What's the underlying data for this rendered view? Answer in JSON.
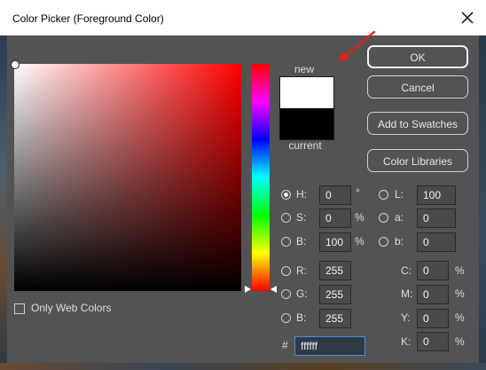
{
  "window": {
    "title": "Color Picker (Foreground Color)"
  },
  "preview": {
    "new_label": "new",
    "current_label": "current",
    "new_color": "#ffffff",
    "current_color": "#000000"
  },
  "buttons": {
    "ok": "OK",
    "cancel": "Cancel",
    "add_to_swatches": "Add to Swatches",
    "color_libraries": "Color Libraries"
  },
  "hsb": {
    "h": {
      "label": "H:",
      "value": "0",
      "unit": "°"
    },
    "s": {
      "label": "S:",
      "value": "0",
      "unit": "%"
    },
    "b": {
      "label": "B:",
      "value": "100",
      "unit": "%"
    }
  },
  "lab": {
    "l": {
      "label": "L:",
      "value": "100"
    },
    "a": {
      "label": "a:",
      "value": "0"
    },
    "b": {
      "label": "b:",
      "value": "0"
    }
  },
  "rgb": {
    "r": {
      "label": "R:",
      "value": "255"
    },
    "g": {
      "label": "G:",
      "value": "255"
    },
    "b": {
      "label": "B:",
      "value": "255"
    }
  },
  "cmyk": {
    "c": {
      "label": "C:",
      "value": "0",
      "unit": "%"
    },
    "m": {
      "label": "M:",
      "value": "0",
      "unit": "%"
    },
    "y": {
      "label": "Y:",
      "value": "0",
      "unit": "%"
    },
    "k": {
      "label": "K:",
      "value": "0",
      "unit": "%"
    }
  },
  "hex": {
    "label": "#",
    "value": "ffffff"
  },
  "only_web_colors": {
    "label": "Only Web Colors",
    "checked": false
  },
  "selected_mode": "H"
}
